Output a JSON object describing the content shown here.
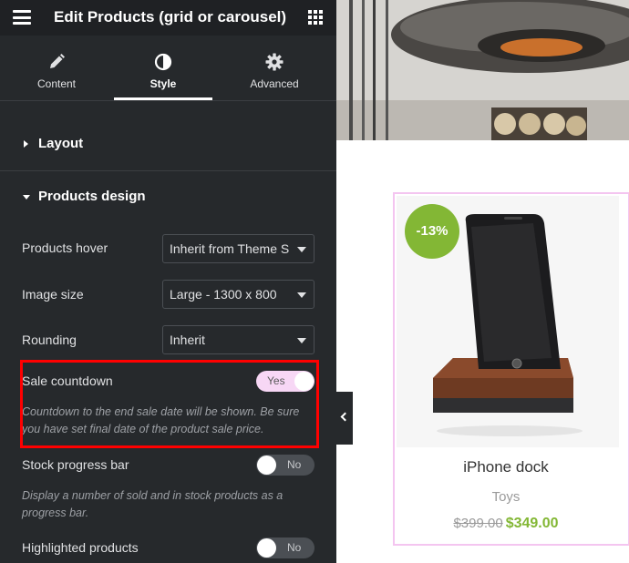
{
  "editor": {
    "title": "Edit Products (grid or carousel)",
    "tabs": [
      {
        "label": "Content",
        "icon": "pencil-icon",
        "active": false
      },
      {
        "label": "Style",
        "icon": "half-circle-contrast-icon",
        "active": true
      },
      {
        "label": "Advanced",
        "icon": "gear-icon",
        "active": false
      }
    ],
    "sections": {
      "layout": {
        "label": "Layout",
        "expanded": false
      },
      "products_design": {
        "label": "Products design",
        "expanded": true
      }
    },
    "controls": {
      "products_hover": {
        "label": "Products hover",
        "value": "Inherit from Theme S"
      },
      "image_size": {
        "label": "Image size",
        "value": "Large - 1300 x 800"
      },
      "rounding": {
        "label": "Rounding",
        "value": "Inherit"
      },
      "sale_countdown": {
        "label": "Sale countdown",
        "state": "Yes",
        "enabled": true,
        "description": "Countdown to the end sale date will be shown. Be sure you have set final date of the product sale price."
      },
      "stock_progress_bar": {
        "label": "Stock progress bar",
        "state": "No",
        "enabled": false,
        "description": "Display a number of sold and in stock products as a progress bar."
      },
      "highlighted_products": {
        "label": "Highlighted products",
        "state": "No",
        "enabled": false
      }
    }
  },
  "preview": {
    "product": {
      "badge": "-13%",
      "title": "iPhone dock",
      "category": "Toys",
      "old_price": "$399.00",
      "new_price": "$349.00"
    }
  },
  "colors": {
    "panel_bg": "#26292c",
    "topbar_bg": "#1f2124",
    "toggle_on": "#f7d7f5",
    "highlight": "#ff0000",
    "sale_green": "#83b735",
    "card_border": "#f4c5f0"
  }
}
